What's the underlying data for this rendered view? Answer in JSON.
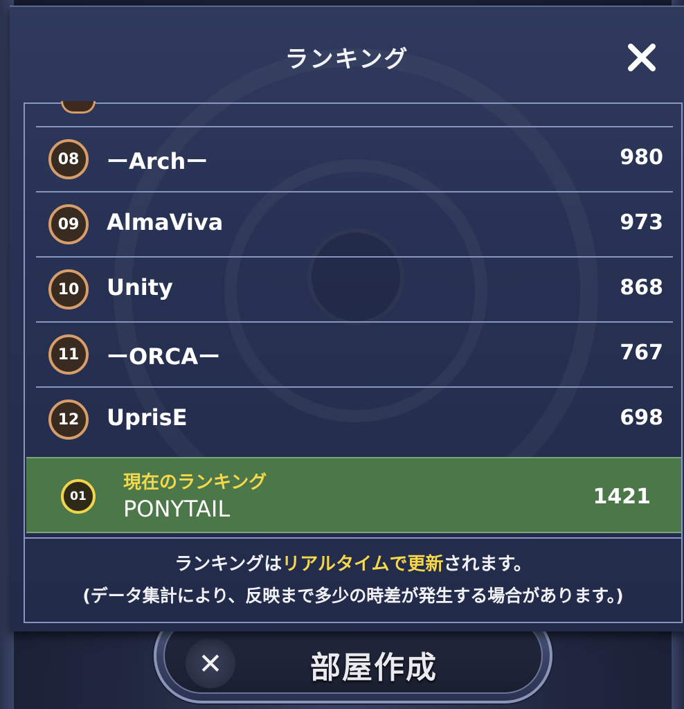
{
  "dialog": {
    "title": "ランキング",
    "close_icon": "close-icon"
  },
  "rankings": [
    {
      "rank": "08",
      "name": "ーArchー",
      "score": "980"
    },
    {
      "rank": "09",
      "name": "AlmaViva",
      "score": "973"
    },
    {
      "rank": "10",
      "name": "Unity",
      "score": "868"
    },
    {
      "rank": "11",
      "name": "ーORCAー",
      "score": "767"
    },
    {
      "rank": "12",
      "name": "UprisE",
      "score": "698"
    }
  ],
  "current": {
    "label": "現在のランキング",
    "rank": "01",
    "name": "PONYTAIL",
    "score": "1421"
  },
  "notice": {
    "line1_a": "ランキングは",
    "line1_highlight": "リアルタイムで更新",
    "line1_b": "されます。",
    "line2": "(データ集計により、反映まで多少の時差が発生する場合があります。)"
  },
  "create_room": {
    "label": "部屋作成",
    "icon": "crossed-swords-icon"
  },
  "colors": {
    "highlight": "#f6d84a",
    "current_row": "#4c7748",
    "badge_ring": "#d79e6c"
  }
}
